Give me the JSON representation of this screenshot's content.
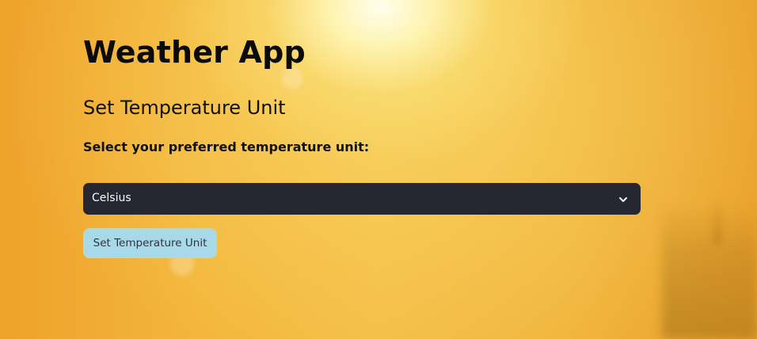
{
  "page": {
    "title": "Weather App",
    "subtitle": "Set Temperature Unit",
    "prompt_label": "Select your preferred temperature unit:"
  },
  "unit_select": {
    "selected": "Celsius",
    "icon": "chevron-down-icon"
  },
  "submit_button": {
    "label": "Set Temperature Unit"
  },
  "colors": {
    "background_accent": "#f0a929",
    "select_bg": "#262730",
    "select_text": "#fafafa",
    "button_bg": "#a8d9e8",
    "button_text": "#31333f"
  }
}
